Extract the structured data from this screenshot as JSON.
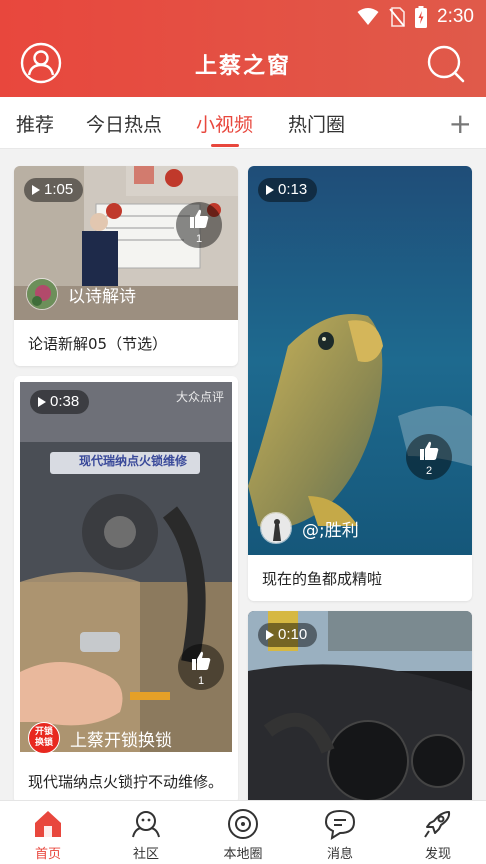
{
  "status_bar": {
    "time": "2:30"
  },
  "header": {
    "title": "上蔡之窗"
  },
  "tabs": [
    {
      "label": "推荐",
      "active": false
    },
    {
      "label": "今日热点",
      "active": false
    },
    {
      "label": "小视频",
      "active": true
    },
    {
      "label": "热门圈",
      "active": false
    }
  ],
  "tabs_add_label": "+",
  "videos": [
    {
      "duration": "1:05",
      "likes": "1",
      "author": "以诗解诗",
      "title": "论语新解05（节选）"
    },
    {
      "duration": "0:13",
      "likes": "2",
      "author": "@;胜利",
      "title": "现在的鱼都成精啦"
    },
    {
      "duration": "0:38",
      "likes": "1",
      "author": "上蔡开锁换锁",
      "author_badge": "开锁换锁",
      "overlay_text": "现代瑞纳点火锁维修",
      "watermark": "大众点评",
      "title": "现代瑞纳点火锁拧不动维修。"
    },
    {
      "duration": "0:10"
    }
  ],
  "bottom_nav": [
    {
      "label": "首页",
      "icon": "home-icon",
      "active": true
    },
    {
      "label": "社区",
      "icon": "community-icon",
      "active": false
    },
    {
      "label": "本地圈",
      "icon": "local-circle-icon",
      "active": false
    },
    {
      "label": "消息",
      "icon": "message-icon",
      "active": false
    },
    {
      "label": "发现",
      "icon": "rocket-icon",
      "active": false
    }
  ],
  "colors": {
    "brand": "#e8473d",
    "text": "#333333"
  }
}
